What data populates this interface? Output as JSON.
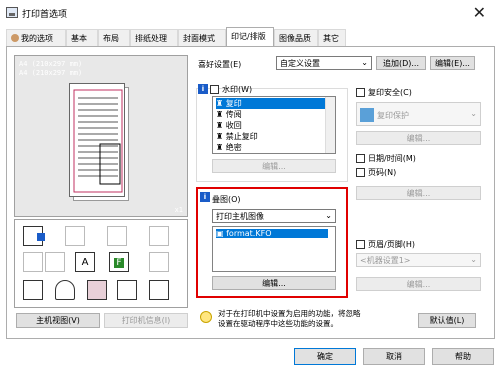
{
  "window": {
    "title": "打印首选项",
    "close_glyph": "✕"
  },
  "tabs": [
    {
      "label": "我的选项"
    },
    {
      "label": "基本"
    },
    {
      "label": "布局"
    },
    {
      "label": "排纸处理"
    },
    {
      "label": "封面模式"
    },
    {
      "label": "印记/排版"
    },
    {
      "label": "图像品质"
    },
    {
      "label": "其它"
    }
  ],
  "preview": {
    "paper_line1": "A4 (210x297 mm)",
    "paper_line2": "A4 (210x297 mm)",
    "scale": "x1",
    "host_view_button": "主机视图(V)",
    "printer_info_button": "打印机信息(I)"
  },
  "favorites": {
    "label": "喜好设置(E)",
    "value": "自定义设置",
    "add_button": "追加(D)...",
    "edit_button": "编辑(E)..."
  },
  "watermark": {
    "label": "水印(W)",
    "items": [
      "复印",
      "传阅",
      "收回",
      "禁止复印",
      "绝密"
    ],
    "selected_index": 0,
    "edit_button": "编辑..."
  },
  "overlay": {
    "label": "叠图(O)",
    "select_value": "打印主机图像",
    "file": "format.KFO",
    "edit_button": "编辑..."
  },
  "copy_security": {
    "label": "复印安全(C)",
    "value": "复印保护",
    "edit_button": "编辑..."
  },
  "datetime": {
    "label": "日期/时间(M)"
  },
  "page_number": {
    "label": "页码(N)",
    "edit_button": "编辑..."
  },
  "header_footer": {
    "label": "页眉/页脚(H)",
    "value": "<机器设置1>",
    "edit_button": "编辑..."
  },
  "notice": {
    "text_line1": "对于在打印机中设置为启用的功能，将忽略",
    "text_line2": "设置在驱动程序中这些功能的设置。"
  },
  "default_button": "默认值(L)",
  "footer": {
    "ok": "确定",
    "cancel": "取消",
    "help": "帮助"
  },
  "colors": {
    "accent": "#0078d7",
    "highlight_border": "#e00000"
  }
}
